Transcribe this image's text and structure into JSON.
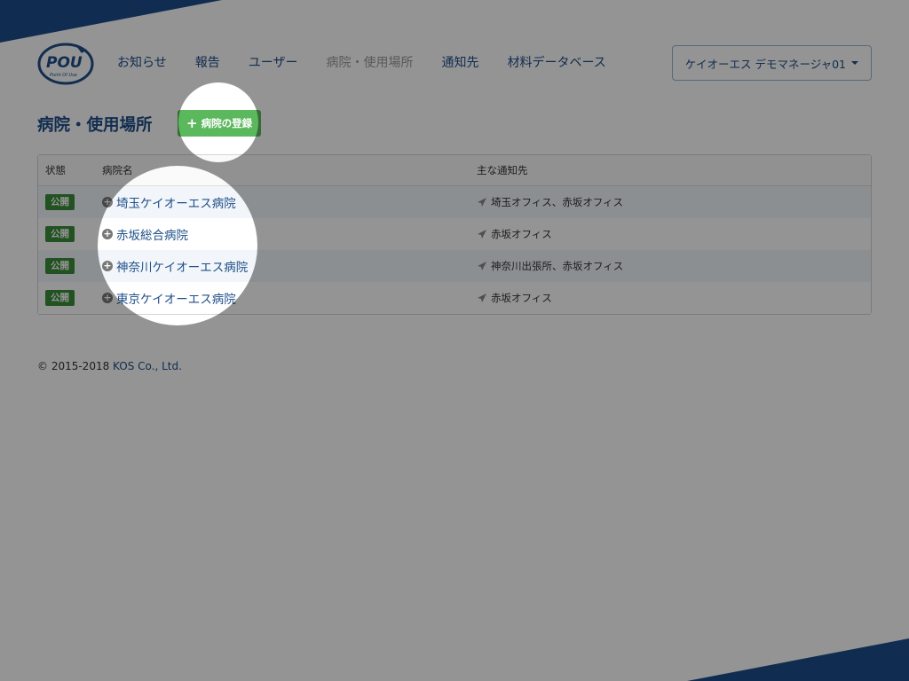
{
  "brand": {
    "logo_text": "POU",
    "logo_sub": "Point Of Use"
  },
  "nav": {
    "items": [
      {
        "label": "お知らせ"
      },
      {
        "label": "報告"
      },
      {
        "label": "ユーザー"
      },
      {
        "label": "病院・使用場所",
        "active": true
      },
      {
        "label": "通知先"
      },
      {
        "label": "材料データベース"
      }
    ],
    "user_label": "ケイオーエス デモマネージャ01"
  },
  "page": {
    "title": "病院・使用場所",
    "add_button_label": "病院の登録"
  },
  "table": {
    "headers": {
      "status": "状態",
      "hospital": "病院名",
      "notify": "主な通知先"
    },
    "rows": [
      {
        "status": "公開",
        "hospital": "埼玉ケイオーエス病院",
        "notify": "埼玉オフィス、赤坂オフィス"
      },
      {
        "status": "公開",
        "hospital": "赤坂総合病院",
        "notify": "赤坂オフィス"
      },
      {
        "status": "公開",
        "hospital": "神奈川ケイオーエス病院",
        "notify": "神奈川出張所、赤坂オフィス"
      },
      {
        "status": "公開",
        "hospital": "東京ケイオーエス病院",
        "notify": "赤坂オフィス"
      }
    ]
  },
  "footer": {
    "copyright": "© 2015-2018 ",
    "company": "KOS Co., Ltd."
  },
  "colors": {
    "primary": "#1f4e89",
    "success": "#5cb85c",
    "badge": "#3c8e3c"
  }
}
